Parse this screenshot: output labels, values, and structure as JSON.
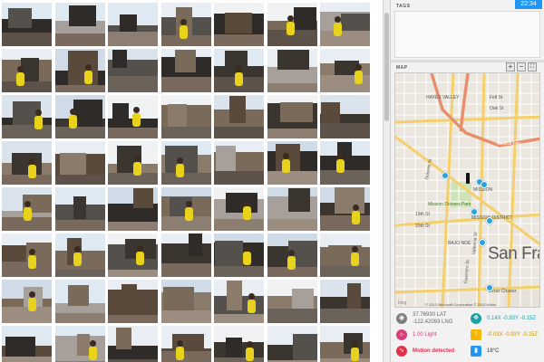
{
  "status": {
    "time": "22:34"
  },
  "tags": {
    "title": "TAGS"
  },
  "map": {
    "title": "MAP",
    "controls": {
      "zoom_in": "+",
      "zoom_out": "−",
      "expand": "⛶"
    },
    "labels": {
      "hayes_valley": "HAYES VALLEY",
      "fell": "Fell St",
      "oak": "Oak St",
      "central": "Central Fwy",
      "mission": "MISSION",
      "mission_district": "MISSION DISTRICT",
      "dolores": "Dolores St",
      "valencia": "Valencia St",
      "guerrero": "Guerrero St",
      "nineteenth": "19th St",
      "twentieth": "20th St",
      "dolores_park": "Mission Dolores Park",
      "bajo_noe": "BAJO NOE",
      "cesar": "Cesar Chavez"
    },
    "city": "San Fra",
    "copyright": "© 2013 Microsoft Corporation © 2013 Nokia",
    "logo": "bing",
    "pins": [
      {
        "lat": 37.762,
        "lng": -122.4275
      },
      {
        "lat": 37.761,
        "lng": -122.4205
      },
      {
        "lat": 37.7605,
        "lng": -122.4195
      },
      {
        "lat": 37.756,
        "lng": -122.4215
      },
      {
        "lat": 37.7545,
        "lng": -122.4185
      },
      {
        "lat": 37.751,
        "lng": -122.42
      },
      {
        "lat": 37.7435,
        "lng": -122.4185
      }
    ]
  },
  "sensors": {
    "location": {
      "icon": "location-icon",
      "lat": "37.76930 LAT",
      "lng": "-122.42093 LNG"
    },
    "accel": {
      "icon": "accelerometer-icon",
      "values": "0.14X   -0.93Y  -0.15Z"
    },
    "light": {
      "icon": "light-icon",
      "label": "1.00 Light"
    },
    "warning": {
      "icon": "warning-icon",
      "values": "-0.03X   -0.92Y  -0.15Z"
    },
    "motion": {
      "icon": "motion-icon",
      "label": "Motion detected"
    },
    "temp": {
      "icon": "thermometer-icon",
      "label": "18°C"
    }
  },
  "colors": {
    "accent_blue": "#2196f3",
    "pin": "#29a3df",
    "light_pink": "#d83c7a",
    "motion_red": "#e0324d",
    "warning_yellow": "#f5b800",
    "teal": "#1aa3a3",
    "location_grey": "#7d7d7d"
  }
}
